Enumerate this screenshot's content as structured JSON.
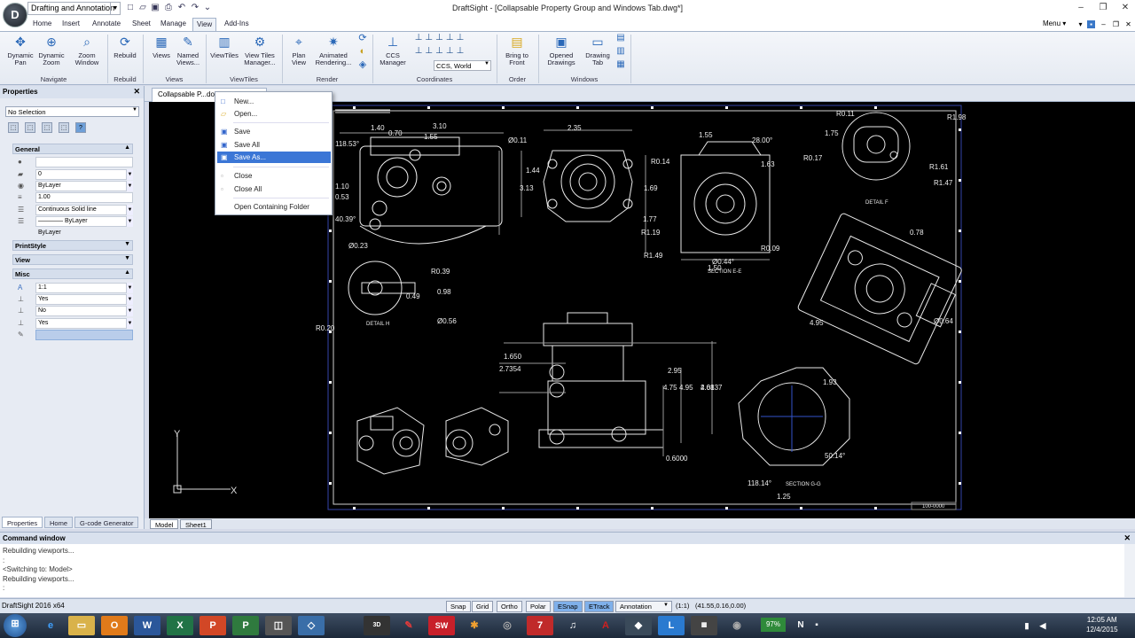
{
  "window": {
    "title": "DraftSight - [Collapsable Property Group and Windows Tab.dwg*]",
    "workspace": "Drafting and Annotation",
    "logo": "D"
  },
  "ribbon_tabs": [
    "Home",
    "Insert",
    "Annotate",
    "Sheet",
    "Manage",
    "View",
    "Add-Ins"
  ],
  "active_tab": "View",
  "menu_label": "Menu",
  "ribbon": {
    "buttons": [
      {
        "label": "Dynamic\nPan",
        "icon": "pan-icon"
      },
      {
        "label": "Dynamic\nZoom",
        "icon": "zoom-icon"
      },
      {
        "label": "Zoom\nWindow",
        "icon": "zoom-window-icon"
      },
      {
        "label": "Rebuild",
        "icon": "rebuild-icon"
      },
      {
        "label": "Views",
        "icon": "views-icon"
      },
      {
        "label": "Named\nViews...",
        "icon": "named-views-icon"
      },
      {
        "label": "ViewTiles",
        "icon": "viewtiles-icon"
      },
      {
        "label": "View Tiles\nManager...",
        "icon": "viewtiles-manager-icon"
      },
      {
        "label": "Plan\nView",
        "icon": "plan-view-icon"
      },
      {
        "label": "Animated\nRendering...",
        "icon": "render-icon"
      },
      {
        "label": "CCS\nManager",
        "icon": "ccs-icon"
      },
      {
        "label": "Bring to\nFront",
        "icon": "bring-front-icon"
      },
      {
        "label": "Opened\nDrawings",
        "icon": "opened-drawings-icon"
      },
      {
        "label": "Drawing\nTab",
        "icon": "drawing-tab-icon"
      }
    ],
    "groups": [
      "Navigate",
      "Rebuild",
      "Views",
      "ViewTiles",
      "Render",
      "Coordinates",
      "Order",
      "Windows"
    ],
    "ccs_value": "CCS, World"
  },
  "properties": {
    "title": "Properties",
    "selection": "No Selection",
    "categories": [
      "General",
      "PrintStyle",
      "View",
      "Misc"
    ],
    "general_rows": [
      "",
      "0",
      "ByLayer",
      "1.00",
      "Continuous     Solid line",
      "———— ByLayer",
      "ByLayer"
    ],
    "misc_rows": [
      "1:1",
      "Yes",
      "No",
      "Yes"
    ],
    "tabs": [
      "Properties",
      "Home",
      "G-code Generator"
    ]
  },
  "document_tab": "Collapsable P...dows",
  "context_menu": {
    "items": [
      "New...",
      "Open...",
      "Save",
      "Save All",
      "Save As...",
      "Close",
      "Close All",
      "Open Containing Folder"
    ],
    "highlighted": "Save As..."
  },
  "sheet_tabs": [
    "Model",
    "Sheet1"
  ],
  "command_window": {
    "title": "Command window",
    "lines": [
      "Rebuilding viewports...",
      ":",
      "<Switching to: Model>",
      "Rebuilding viewports...",
      ":"
    ]
  },
  "statusbar": {
    "app_version": "DraftSight 2016 x64",
    "toggles": [
      "Snap",
      "Grid",
      "Ortho",
      "Polar",
      "ESnap",
      "ETrack"
    ],
    "active_toggles": [
      "ESnap",
      "ETrack"
    ],
    "annotation": "Annotation",
    "scale": "(1:1)",
    "coordinates": "(41.55,0.16,0.00)"
  },
  "taskbar": {
    "time": "12:05 AM",
    "date": "12/4/2015",
    "battery": "97%"
  },
  "drawing": {
    "labels": [
      "R1.98",
      "R0.11",
      "R0.17",
      "R1.61",
      "R1.47",
      "DETAIL F",
      "1.75",
      "1.55",
      "28.00°",
      "1.63",
      "R0.14",
      "1.69",
      "1.77",
      "R1.19",
      "R1.49",
      "1.50",
      "2.35",
      "1.44",
      "3.13",
      "Ø0.11",
      "3.10",
      "1.55",
      "1.40",
      "0.70",
      "118.53°",
      "1.10",
      "0.53",
      "40.39°",
      "Ø0.23",
      "R0.39",
      "0.98",
      "0.49",
      "Ø0.56",
      "R0.20",
      "DETAIL H",
      "SECTION E-E",
      "R0.09",
      "0.78",
      "4.95",
      "Ø0.64",
      "2.95",
      "4.75",
      "4.95",
      "2.08",
      "1.93",
      "50.14°",
      "118.14°",
      "SECTION G-G",
      "1.25",
      "Ø0.44°",
      "0.6000",
      "1.650",
      "2.7354",
      "4.6137"
    ],
    "title_block": "100-0000"
  }
}
